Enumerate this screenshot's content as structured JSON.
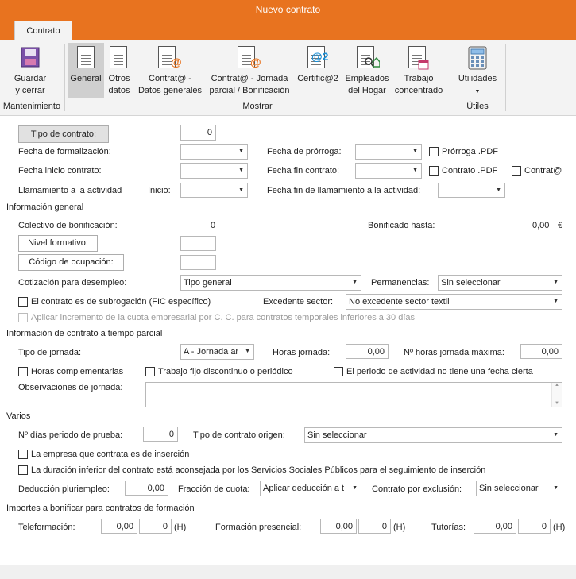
{
  "window": {
    "title": "Nuevo contrato"
  },
  "ribbon": {
    "tab": "Contrato",
    "buttons": {
      "guardar": "Guardar\ny cerrar",
      "general": "General",
      "otros": "Otros\ndatos",
      "contrata_datos": "Contrat@ -\nDatos generales",
      "contrata_jornada": "Contrat@ - Jornada\nparcial / Bonificación",
      "certifica": "Certific@2",
      "empleados": "Empleados\ndel Hogar",
      "trabajo": "Trabajo\nconcentrado",
      "utilidades": "Utilidades"
    },
    "groups": {
      "mantenimiento": "Mantenimiento",
      "mostrar": "Mostrar",
      "utiles": "Útiles"
    }
  },
  "form": {
    "tipo_contrato_btn": "Tipo de contrato:",
    "tipo_contrato_val": "0",
    "fecha_formalizacion": "Fecha de formalización:",
    "fecha_prorroga": "Fecha de prórroga:",
    "prorroga_pdf": "Prórroga .PDF",
    "fecha_inicio": "Fecha inicio contrato:",
    "fecha_fin": "Fecha fin contrato:",
    "contrato_pdf": "Contrato .PDF",
    "contrata": "Contrat@",
    "llamamiento": "Llamamiento a la actividad",
    "inicio": "Inicio:",
    "fecha_fin_llamamiento": "Fecha fin de llamamiento a la actividad:",
    "info_general": "Información general",
    "colectivo": "Colectivo de bonificación:",
    "colectivo_val": "0",
    "bonificado_hasta": "Bonificado hasta:",
    "bonificado_val": "0,00",
    "euro": "€",
    "nivel_formativo": "Nivel formativo:",
    "codigo_ocupacion": "Código de ocupación:",
    "cotizacion": "Cotización para desempleo:",
    "cotizacion_val": "Tipo general",
    "permanencias": "Permanencias:",
    "permanencias_val": "Sin seleccionar",
    "subrogacion": "El contrato es de subrogación (FIC específico)",
    "excedente": "Excedente sector:",
    "excedente_val": "No excedente sector textil",
    "incremento": "Aplicar incremento de la cuota empresarial por C. C. para contratos temporales inferiores a 30 días",
    "info_parcial": "Información de contrato a tiempo parcial",
    "tipo_jornada": "Tipo de jornada:",
    "tipo_jornada_val": "A - Jornada ar",
    "horas_jornada": "Horas jornada:",
    "horas_jornada_val": "0,00",
    "horas_max": "Nº horas jornada máxima:",
    "horas_max_val": "0,00",
    "horas_comp": "Horas complementarias",
    "fijo_discontinuo": "Trabajo fijo discontinuo o periódico",
    "periodo_actividad": "El periodo de actividad no tiene una fecha cierta",
    "observaciones": "Observaciones de jornada:",
    "varios": "Varios",
    "dias_prueba": "Nº días periodo de prueba:",
    "dias_prueba_val": "0",
    "tipo_origen": "Tipo de contrato origen:",
    "tipo_origen_val": "Sin seleccionar",
    "empresa_insercion": "La empresa que contrata es de inserción",
    "duracion_inferior": "La duración inferior del contrato está aconsejada por los Servicios Sociales Públicos para el seguimiento de inserción",
    "deduccion": "Deducción pluriempleo:",
    "deduccion_val": "0,00",
    "fraccion": "Fracción de cuota:",
    "fraccion_val": "Aplicar deducción a t",
    "exclusion": "Contrato por exclusión:",
    "exclusion_val": "Sin seleccionar",
    "importes": "Importes a bonificar para contratos de formación",
    "teleformacion": "Teleformación:",
    "teleformacion_val": "0,00",
    "teleformacion_h": "0",
    "presencial": "Formación presencial:",
    "presencial_val": "0,00",
    "presencial_h": "0",
    "tutorias": "Tutorías:",
    "tutorias_val": "0,00",
    "tutorias_h": "0",
    "h_unit": "(H)"
  },
  "colors": {
    "accent": "#e8731f",
    "ribbon": "#f3f3f3",
    "active": "#cfcfcf"
  }
}
